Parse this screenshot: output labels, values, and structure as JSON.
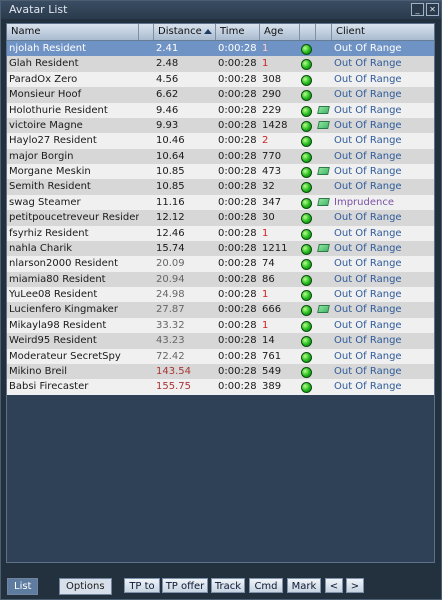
{
  "window": {
    "title": "Avatar List"
  },
  "columns": {
    "name": "Name",
    "distance": "Distance",
    "time": "Time",
    "age": "Age",
    "client": "Client"
  },
  "rows": [
    {
      "name": "njolah Resident",
      "distance": "2.41",
      "time": "0:00:28",
      "age": "1",
      "status": "online",
      "extra": "",
      "client": "Out Of Range"
    },
    {
      "name": "Glah Resident",
      "distance": "2.48",
      "time": "0:00:28",
      "age": "1",
      "status": "online",
      "extra": "",
      "client": "Out Of Range"
    },
    {
      "name": "ParadOx Zero",
      "distance": "4.56",
      "time": "0:00:28",
      "age": "308",
      "status": "online",
      "extra": "",
      "client": "Out Of Range"
    },
    {
      "name": "Monsieur Hoof",
      "distance": "6.62",
      "time": "0:00:28",
      "age": "290",
      "status": "online",
      "extra": "",
      "client": "Out Of Range"
    },
    {
      "name": "Holothurie Resident",
      "distance": "9.46",
      "time": "0:00:28",
      "age": "229",
      "status": "online",
      "extra": "money",
      "client": "Out Of Range"
    },
    {
      "name": "victoire Magne",
      "distance": "9.93",
      "time": "0:00:28",
      "age": "1428",
      "status": "online",
      "extra": "money",
      "client": "Out Of Range"
    },
    {
      "name": "Haylo27 Resident",
      "distance": "10.46",
      "time": "0:00:28",
      "age": "2",
      "status": "online",
      "extra": "",
      "client": "Out Of Range"
    },
    {
      "name": "major Borgin",
      "distance": "10.64",
      "time": "0:00:28",
      "age": "770",
      "status": "online",
      "extra": "",
      "client": "Out Of Range"
    },
    {
      "name": "Morgane Meskin",
      "distance": "10.85",
      "time": "0:00:28",
      "age": "473",
      "status": "online",
      "extra": "money",
      "client": "Out Of Range"
    },
    {
      "name": "Semith Resident",
      "distance": "10.85",
      "time": "0:00:28",
      "age": "32",
      "status": "online",
      "extra": "",
      "client": "Out Of Range"
    },
    {
      "name": "swag Steamer",
      "distance": "11.16",
      "time": "0:00:28",
      "age": "347",
      "status": "online",
      "extra": "money",
      "client": "Imprudence"
    },
    {
      "name": "petitpoucetreveur Resident",
      "distance": "12.12",
      "time": "0:00:28",
      "age": "30",
      "status": "online",
      "extra": "",
      "client": "Out Of Range"
    },
    {
      "name": "fsyrhiz Resident",
      "distance": "12.46",
      "time": "0:00:28",
      "age": "1",
      "status": "online",
      "extra": "",
      "client": "Out Of Range"
    },
    {
      "name": "nahla Charik",
      "distance": "15.74",
      "time": "0:00:28",
      "age": "1211",
      "status": "online",
      "extra": "money",
      "client": "Out Of Range"
    },
    {
      "name": "nlarson2000 Resident",
      "distance": "20.09",
      "time": "0:00:28",
      "age": "74",
      "status": "online",
      "extra": "",
      "client": "Out Of Range"
    },
    {
      "name": "miamia80 Resident",
      "distance": "20.94",
      "time": "0:00:28",
      "age": "86",
      "status": "online",
      "extra": "",
      "client": "Out Of Range"
    },
    {
      "name": "YuLee08 Resident",
      "distance": "24.98",
      "time": "0:00:28",
      "age": "1",
      "status": "online",
      "extra": "",
      "client": "Out Of Range"
    },
    {
      "name": "Lucienfero Kingmaker",
      "distance": "27.87",
      "time": "0:00:28",
      "age": "666",
      "status": "online",
      "extra": "money",
      "client": "Out Of Range"
    },
    {
      "name": "Mikayla98 Resident",
      "distance": "33.32",
      "time": "0:00:28",
      "age": "1",
      "status": "online",
      "extra": "",
      "client": "Out Of Range"
    },
    {
      "name": "Weird95 Resident",
      "distance": "43.23",
      "time": "0:00:28",
      "age": "14",
      "status": "online",
      "extra": "",
      "client": "Out Of Range"
    },
    {
      "name": "Moderateur SecretSpy",
      "distance": "72.42",
      "time": "0:00:28",
      "age": "761",
      "status": "online",
      "extra": "",
      "client": "Out Of Range"
    },
    {
      "name": "Mikino Breil",
      "distance": "143.54",
      "time": "0:00:28",
      "age": "549",
      "status": "online",
      "extra": "",
      "client": "Out Of Range"
    },
    {
      "name": "Babsi Firecaster",
      "distance": "155.75",
      "time": "0:00:28",
      "age": "389",
      "status": "online",
      "extra": "",
      "client": "Out Of Range"
    }
  ],
  "footer": {
    "tabs": [
      "List",
      "Options"
    ],
    "buttons": [
      "TP to",
      "TP offer",
      "Track",
      "Cmd",
      "Mark",
      "<",
      ">"
    ]
  },
  "colors": {
    "window_bg": "#23313f",
    "header_bg": "#c5d3e2",
    "selected_row": "#6f93c4",
    "alt_row": "#d7d7d7",
    "age_new": "#cc2222",
    "distance_near": "#1a1a1a",
    "distance_mid": "#666666",
    "distance_far": "#a93434",
    "client_text": "#2e5b99",
    "client_imprudence": "#7a52a6"
  },
  "icons": {
    "status_online": "green-dot-icon",
    "payment": "money-icon",
    "sort": "sort-ascending-icon"
  }
}
